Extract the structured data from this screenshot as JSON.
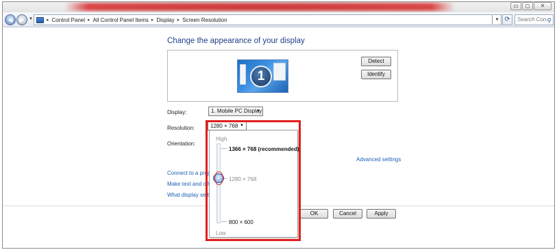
{
  "window": {
    "title_bar": {
      "min_glyph": "▭",
      "max_glyph": "◻",
      "close_glyph": "✕"
    },
    "address": {
      "breadcrumb": [
        "Control Panel",
        "All Control Panel Items",
        "Display",
        "Screen Resolution"
      ],
      "search_placeholder": "Search Con..."
    }
  },
  "main": {
    "heading": "Change the appearance of your display",
    "monitor_number": "1",
    "detect_label": "Detect",
    "identify_label": "Identify",
    "display_label": "Display:",
    "display_value": "1. Mobile PC Display",
    "resolution_label": "Resolution:",
    "resolution_value": "1280 × 768",
    "orientation_label": "Orientation:",
    "advanced_settings": "Advanced settings",
    "links": [
      "Connect to a proje",
      "Make text and othe",
      "What display settin"
    ],
    "ok_label": "OK",
    "cancel_label": "Cancel",
    "apply_label": "Apply"
  },
  "resolution_popup": {
    "high_label": "High",
    "low_label": "Low",
    "options": [
      {
        "label": "1366 × 768 (recommended)",
        "style": "bold"
      },
      {
        "label": "1280 × 768",
        "style": "gray"
      },
      {
        "label": "800 × 600",
        "style": "normal"
      }
    ],
    "selected": "1280 × 768",
    "highlight_color": "#e01d1d"
  },
  "colors": {
    "accent_link": "#1a5fb4",
    "heading": "#1f3f8a",
    "highlight": "#e01d1d"
  }
}
